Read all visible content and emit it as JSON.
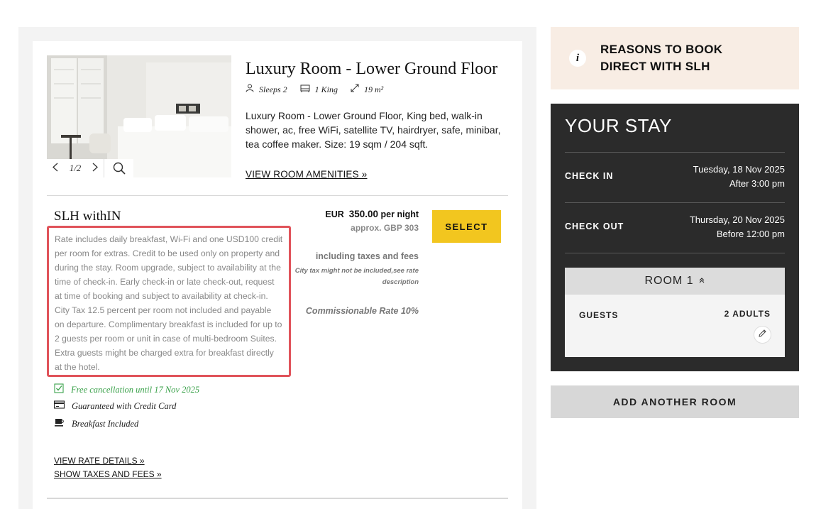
{
  "room": {
    "title": "Luxury Room - Lower Ground Floor",
    "sleeps": "Sleeps 2",
    "bed": "1 King",
    "size": "19 m²",
    "description": "Luxury Room - Lower Ground Floor, King bed, walk-in shower, ac, free WiFi, satellite TV, hairdryer, safe, minibar, tea coffee maker. Size: 19 sqm / 204 sqft.",
    "amenities_link": "VIEW ROOM AMENITIES »",
    "photo_counter": "1/2",
    "icons": [
      "person-icon",
      "bed-icon",
      "expand-icon",
      "chevron-left-icon",
      "chevron-right-icon",
      "search-icon"
    ]
  },
  "rate": {
    "name": "SLH withIN",
    "description": "Rate includes daily breakfast, Wi-Fi and one USD100 credit per room for extras. Credit to be used only on property and during the stay. Room upgrade, subject to availability at the time of check-in. Early check-in or late check-out, request at time of booking and subject to availability at check-in. City Tax 12.5 percent per room not included and payable on departure. Complimentary breakfast is included for up to 2 guests per room or unit in case of multi-bedroom Suites. Extra guests might be charged extra for breakfast directly at the hotel.",
    "currency": "EUR",
    "price": "350.00",
    "per_night": "per night",
    "approx": "approx. GBP 303",
    "taxes": "including taxes and fees",
    "tax_note": "City tax might not be included,see rate description",
    "commission": "Commissionable Rate 10%",
    "select_label": "SELECT",
    "perks": {
      "cancellation": "Free cancellation until 17 Nov 2025",
      "guarantee": "Guaranteed with Credit Card",
      "breakfast": "Breakfast Included"
    },
    "view_details": "VIEW RATE DETAILS »",
    "show_taxes": "SHOW TAXES AND FEES »",
    "accent_color": "#f2c61f",
    "cancel_color": "#3aa14a"
  },
  "reasons": {
    "line1": "REASONS TO BOOK",
    "line2": "DIRECT WITH SLH",
    "icon": "i"
  },
  "stay": {
    "title": "YOUR STAY",
    "check_in_label": "CHECK IN",
    "check_in_date": "Tuesday, 18 Nov 2025",
    "check_in_time": "After 3:00 pm",
    "check_out_label": "CHECK OUT",
    "check_out_date": "Thursday, 20 Nov 2025",
    "check_out_time": "Before 12:00 pm",
    "room_label": "ROOM 1",
    "guests_label": "GUESTS",
    "guests_value": "2 ADULTS",
    "add_room": "ADD ANOTHER ROOM"
  }
}
